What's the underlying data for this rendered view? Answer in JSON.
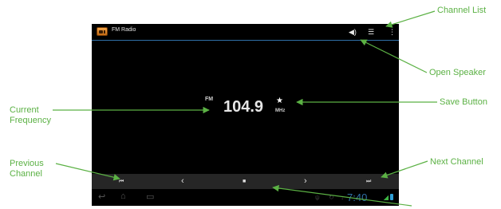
{
  "app": {
    "title": "FM Radio"
  },
  "toolbar": {
    "speaker_icon": "speaker-icon",
    "list_icon": "list-icon",
    "menu_icon": "overflow-menu-icon"
  },
  "frequency": {
    "band": "FM",
    "value": "104.9",
    "unit": "MHz",
    "star_icon": "star-icon"
  },
  "controls": {
    "prev": "prev-channel-icon",
    "seek_down": "chevron-left-icon",
    "stop": "stop-icon",
    "seek_up": "chevron-right-icon",
    "next": "next-channel-icon"
  },
  "status": {
    "time": "7:40"
  },
  "callouts": {
    "channel_list": "Channel List",
    "open_speaker": "Open Speaker",
    "save_button": "Save Button",
    "current_frequency_line1": "Current",
    "current_frequency_line2": "Frequency",
    "previous_channel_line1": "Previous",
    "previous_channel_line2": "Channel",
    "next_channel": "Next Channel"
  },
  "colors": {
    "accent": "#5bb144",
    "screen_bg": "#000000",
    "control_bar": "#262626",
    "clock": "#2f6fa7"
  }
}
